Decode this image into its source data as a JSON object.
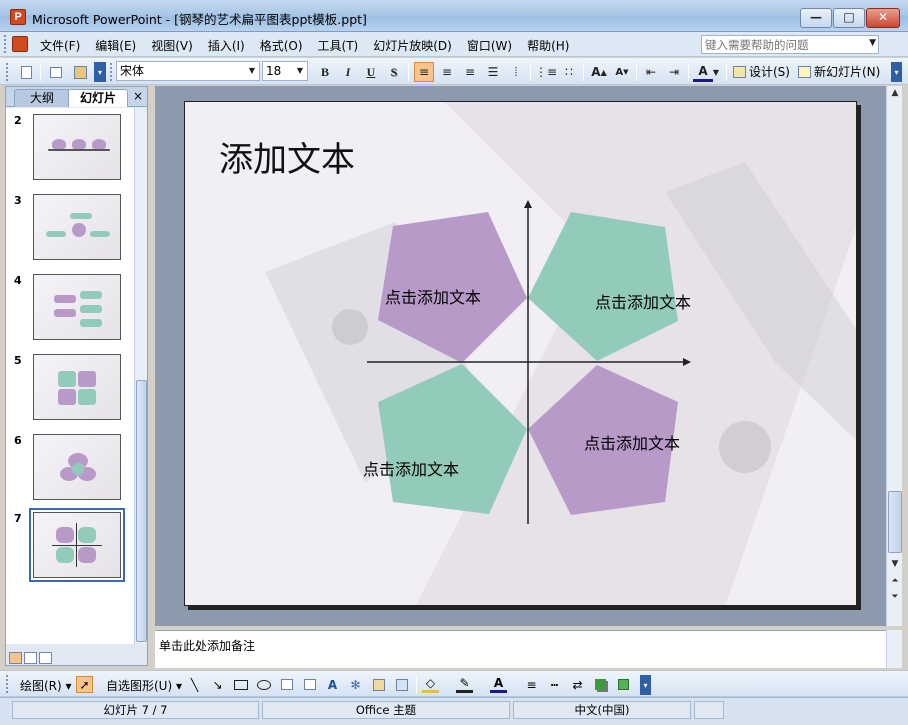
{
  "window": {
    "title": "Microsoft PowerPoint - [钢琴的艺术扁平图表ppt模板.ppt]",
    "app_icon_letter": "P",
    "minimize_label": "—",
    "maximize_label": "□",
    "close_label": "✕"
  },
  "menu": {
    "items": [
      "文件(F)",
      "编辑(E)",
      "视图(V)",
      "插入(I)",
      "格式(O)",
      "工具(T)",
      "幻灯片放映(D)",
      "窗口(W)",
      "帮助(H)"
    ],
    "help_placeholder": "键入需要帮助的问题"
  },
  "format_toolbar": {
    "font": "宋体",
    "font_size": "18",
    "bold": "B",
    "italic": "I",
    "underline": "U",
    "shadow": "S",
    "design_label": "设计(S)",
    "new_slide_label": "新幻灯片(N)"
  },
  "left_pane": {
    "tab_outline": "大纲",
    "tab_slides": "幻灯片",
    "close": "×",
    "thumbnails": [
      {
        "number": "2",
        "selected": false
      },
      {
        "number": "3",
        "selected": false
      },
      {
        "number": "4",
        "selected": false
      },
      {
        "number": "5",
        "selected": false
      },
      {
        "number": "6",
        "selected": false
      },
      {
        "number": "7",
        "selected": true
      }
    ]
  },
  "slide": {
    "title": "添加文本",
    "shapes": [
      {
        "label": "点击添加文本",
        "color": "#b89ac9"
      },
      {
        "label": "点击添加文本",
        "color": "#93cbbb"
      },
      {
        "label": "点击添加文本",
        "color": "#93cbbb"
      },
      {
        "label": "点击添加文本",
        "color": "#b89ac9"
      }
    ]
  },
  "notes": {
    "placeholder": "单击此处添加备注"
  },
  "drawing_toolbar": {
    "draw_label": "绘图(R)",
    "autoshapes_label": "自选图形(U)"
  },
  "status": {
    "slide_position": "幻灯片 7 / 7",
    "theme": "Office 主题",
    "language": "中文(中国)"
  },
  "colors": {
    "purple_shape": "#b89ac9",
    "teal_shape": "#93cbbb",
    "selection_accent": "#3a6bb0"
  }
}
